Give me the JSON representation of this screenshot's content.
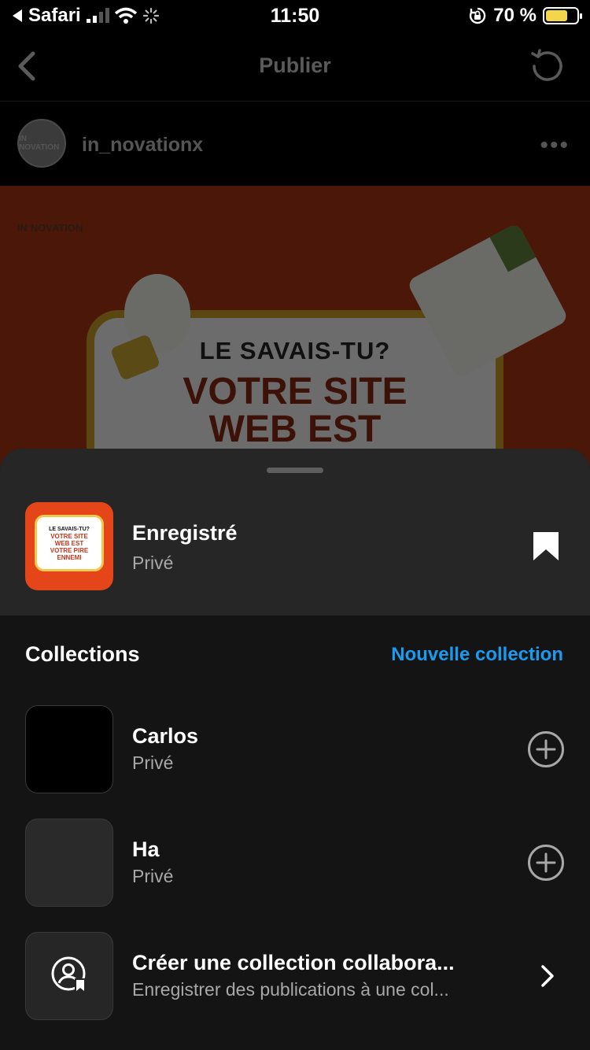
{
  "status_bar": {
    "back_app": "Safari",
    "time": "11:50",
    "battery_percent": "70 %",
    "battery_level": 0.7,
    "battery_color": "#f3d64a"
  },
  "header": {
    "title": "Publier"
  },
  "post": {
    "username": "in_novationx",
    "avatar_text": "IN NOVATION",
    "image": {
      "logo_text": "IN NOVATION",
      "line1": "LE SAVAIS-TU?",
      "line2": "VOTRE SITE",
      "line3": "WEB EST"
    }
  },
  "sheet": {
    "saved": {
      "title": "Enregistré",
      "subtitle": "Privé",
      "thumb_lines": [
        "LE SAVAIS-TU?",
        "VOTRE SITE",
        "WEB EST",
        "VOTRE PIRE",
        "ENNEMI"
      ]
    },
    "collections_label": "Collections",
    "new_collection_label": "Nouvelle collection",
    "accent_color": "#1a9bf0",
    "collections": [
      {
        "title": "Carlos",
        "subtitle": "Privé",
        "thumb_color": "#000000"
      },
      {
        "title": "Ha",
        "subtitle": "Privé",
        "thumb_color": "#2a2a2a"
      }
    ],
    "collab": {
      "title": "Créer une collection collabora...",
      "subtitle": "Enregistrer des publications à une col..."
    }
  }
}
